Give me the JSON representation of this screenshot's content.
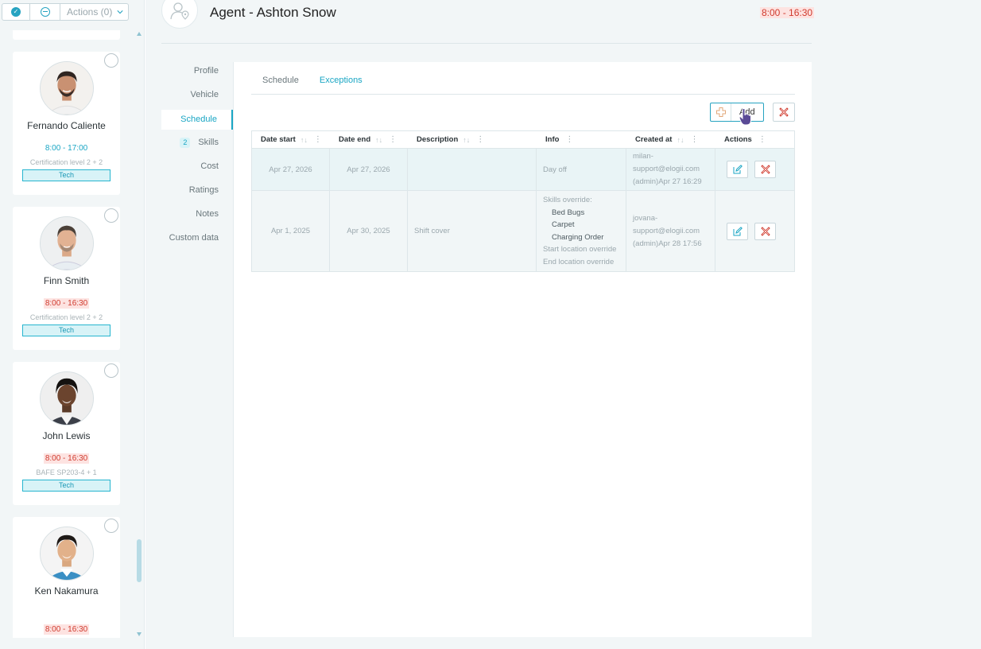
{
  "toolbar": {
    "actions_label": "Actions (0)"
  },
  "agents": [
    {
      "name": "Fernando Caliente",
      "hours": "8:00 - 17:00",
      "hours_status": "ok",
      "cert": "Certification level 2 + 2",
      "tag": "Tech"
    },
    {
      "name": "Finn Smith",
      "hours": "8:00 - 16:30",
      "hours_status": "late",
      "cert": "Certification level 2 + 2",
      "tag": "Tech"
    },
    {
      "name": "John Lewis",
      "hours": "8:00 - 16:30",
      "hours_status": "late",
      "cert": "BAFE SP203-4 + 1",
      "tag": "Tech"
    },
    {
      "name": "Ken Nakamura",
      "hours": "8:00 - 16:30",
      "hours_status": "late",
      "cert": "",
      "tag": ""
    }
  ],
  "header": {
    "title": "Agent - Ashton Snow",
    "hours": "8:00 - 16:30"
  },
  "nav": {
    "profile": "Profile",
    "vehicle": "Vehicle",
    "schedule": "Schedule",
    "skills_count": "2",
    "skills": "Skills",
    "cost": "Cost",
    "ratings": "Ratings",
    "notes": "Notes",
    "custom_data": "Custom data"
  },
  "tabs": {
    "schedule": "Schedule",
    "exceptions": "Exceptions"
  },
  "buttons": {
    "add": "Add"
  },
  "table": {
    "columns": {
      "date_start": "Date start",
      "date_end": "Date end",
      "description": "Description",
      "info": "Info",
      "created_at": "Created at",
      "actions": "Actions"
    },
    "rows": [
      {
        "date_start": "Apr 27, 2026",
        "date_end": "Apr 27, 2026",
        "description": "",
        "info_line": "Day off",
        "created_1": "milan-",
        "created_2": "support@elogii.com",
        "created_3": "(admin)Apr 27 16:29"
      },
      {
        "date_start": "Apr 1, 2025",
        "date_end": "Apr 30, 2025",
        "description": "Shift cover",
        "info_title": "Skills override:",
        "info_skill_1": "Bed Bugs",
        "info_skill_2": "Carpet",
        "info_skill_3": "Charging Order",
        "info_start": "Start location override",
        "info_end": "End location override",
        "created_1": "jovana-",
        "created_2": "support@elogii.com",
        "created_3": "(admin)Apr 28 17:56"
      }
    ]
  },
  "colors": {
    "accent": "#1aa6c4",
    "danger": "#d03b2e",
    "late_bg": "#fde3e1"
  }
}
